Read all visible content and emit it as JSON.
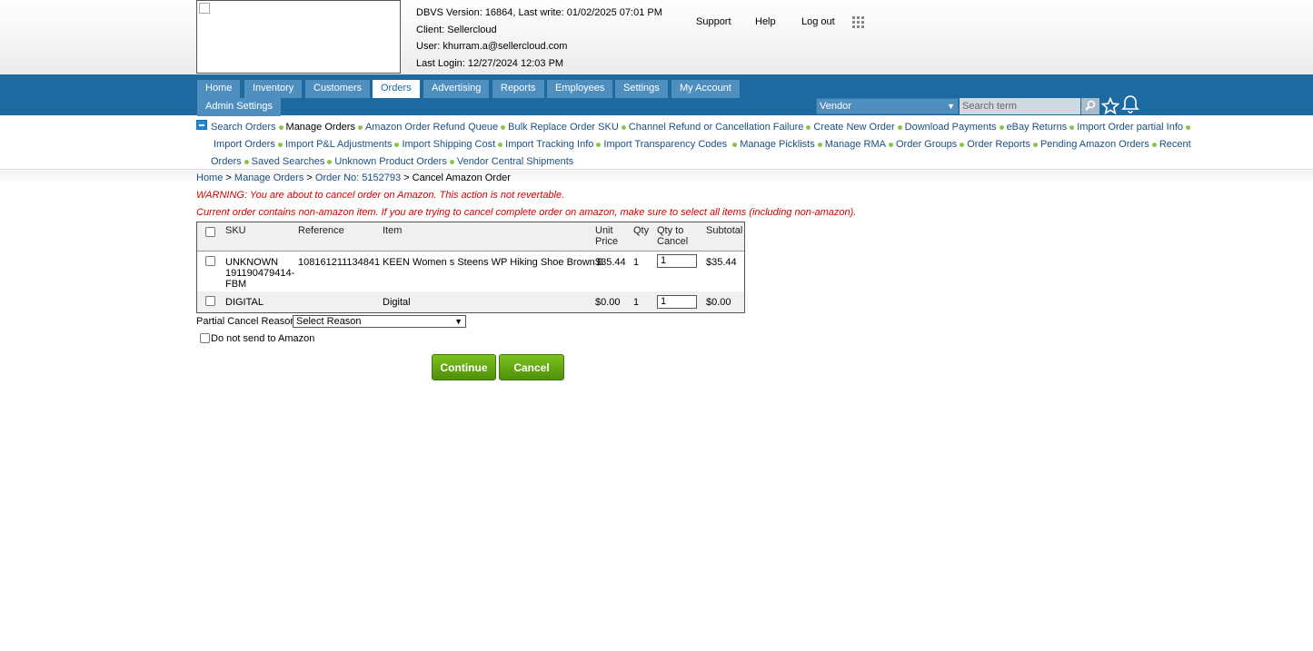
{
  "header": {
    "logo_alt": "",
    "version_line": "DBVS Version: 16864, Last write: 01/02/2025 07:01 PM",
    "client_line": "Client: Sellercloud",
    "user_line": "User: khurram.a@sellercloud.com",
    "login_line": "Last Login: 12/27/2024 12:03 PM",
    "links": {
      "support": "Support",
      "help": "Help",
      "logout": "Log out"
    }
  },
  "nav": {
    "tabs": [
      "Home",
      "Inventory",
      "Customers",
      "Orders",
      "Advertising",
      "Reports",
      "Employees",
      "Settings",
      "My Account",
      "Admin Settings"
    ],
    "active_tab": "Orders",
    "vendor_select": "Vendor",
    "search_placeholder": "Search term"
  },
  "subnav": {
    "items": [
      "Search Orders",
      "Manage Orders",
      "Amazon Order Refund Queue",
      "Bulk Replace Order SKU",
      "Channel Refund or Cancellation Failure",
      "Create New Order",
      "Download Payments",
      "eBay Returns",
      "Import Order partial Info",
      "Import Orders",
      "Import P&L Adjustments",
      "Import Shipping Cost",
      "Import Tracking Info",
      "Import Transparency Codes",
      "Manage Picklists",
      "Manage RMA",
      "Order Groups",
      "Order Reports",
      "Pending Amazon Orders",
      "Recent",
      "Orders",
      "Saved Searches",
      "Unknown Product Orders",
      "Vendor Central Shipments"
    ]
  },
  "breadcrumb": {
    "home": "Home",
    "sep": ">",
    "manage_orders": "Manage Orders",
    "order_no": "Order No: 5152793",
    "current": "Cancel Amazon Order"
  },
  "warnings": {
    "cancel": "WARNING: You are about to cancel order on Amazon. This action is not revertable.",
    "non_amazon": "Current order contains non-amazon item. If you are trying to cancel complete order on amazon, make sure to select all items (including non-amazon)."
  },
  "grid": {
    "headers": {
      "sku": "SKU",
      "reference": "Reference",
      "item": "Item",
      "unit_price_1": "Unit",
      "unit_price_2": "Price",
      "qty": "Qty",
      "qty_cancel_1": "Qty to",
      "qty_cancel_2": "Cancel",
      "subtotal": "Subtotal"
    },
    "rows": [
      {
        "sku_1": "UNKNOWN",
        "sku_2": "191190479414-",
        "sku_3": "FBM",
        "reference": "108161211134841",
        "item": "KEEN Women s Steens WP Hiking Shoe Brown 8",
        "unit_price": "$35.44",
        "qty": "1",
        "qty_to_cancel": "1",
        "subtotal": "$35.44"
      },
      {
        "sku_1": "DIGITAL",
        "reference": "",
        "item": "Digital",
        "unit_price": "$0.00",
        "qty": "1",
        "qty_to_cancel": "1",
        "subtotal": "$0.00"
      }
    ]
  },
  "form": {
    "partial_reason_label": "Partial Cancel Reason:",
    "partial_reason_value": "Select Reason",
    "do_not_send_label": "Do not send to Amazon",
    "continue": "Continue",
    "cancel": "Cancel"
  }
}
